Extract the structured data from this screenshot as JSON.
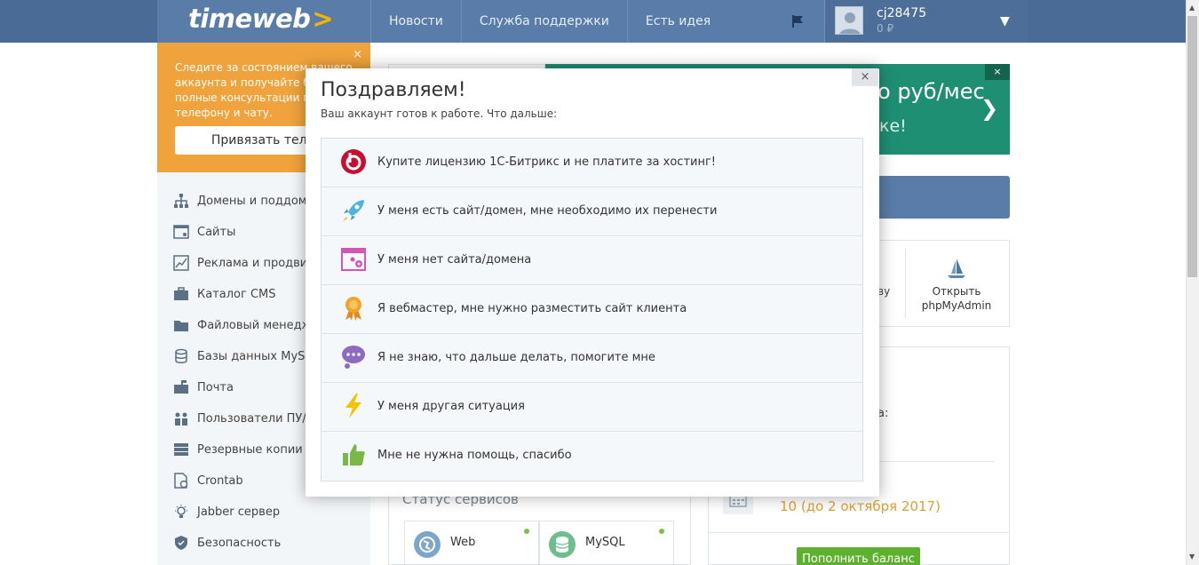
{
  "brand": {
    "logo_text": "timeweb",
    "logo_mark": ">",
    "accent": "#f5b400"
  },
  "nav": {
    "items": [
      "Новости",
      "Служба поддержки",
      "Есть идея"
    ]
  },
  "user": {
    "name": "cj28475",
    "balance": "0 ₽"
  },
  "notification": {
    "text": "Следите за состоянием вашего аккаунта и получайте бо... полные консультации по... телефону и чату.",
    "text_lines": [
      "Следите за состоянием вашего",
      "аккаунта и получайте бо",
      "полные консультации по",
      "телефону и чату."
    ],
    "button_label": "Привязать телеф",
    "close": "×"
  },
  "sidebar": {
    "items": [
      {
        "label": "Домены и поддоме",
        "icon": "sitemap-icon"
      },
      {
        "label": "Сайты",
        "icon": "site-window-icon"
      },
      {
        "label": "Реклама и продвиже",
        "icon": "chart-icon"
      },
      {
        "label": "Каталог CMS",
        "icon": "briefcase-icon"
      },
      {
        "label": "Файловый менеджер",
        "icon": "folder-icon"
      },
      {
        "label": "Базы данных MySQL",
        "icon": "database-icon"
      },
      {
        "label": "Почта",
        "icon": "mailbox-icon"
      },
      {
        "label": "Пользователи ПУ/FT",
        "icon": "users-icon"
      },
      {
        "label": "Резервные копии",
        "icon": "backup-icon"
      },
      {
        "label": "Crontab",
        "icon": "clock-file-icon"
      },
      {
        "label": "Jabber сервер",
        "icon": "bulb-icon"
      },
      {
        "label": "Безопасность",
        "icon": "shield-icon"
      }
    ]
  },
  "promo": {
    "price": "о руб/мес",
    "sub": "ке!",
    "close": "×"
  },
  "tools": {
    "fragment": "ву",
    "phpmyadmin_label_1": "Открыть",
    "phpmyadmin_label_2": "phpMyAdmin"
  },
  "status": {
    "title": "Статус сервисов",
    "services": [
      {
        "name": "Web",
        "color": "#7ea6c8"
      },
      {
        "name": "MySQL",
        "color": "#6cbf8c"
      }
    ]
  },
  "info": {
    "colon_fragment": "а:",
    "days_text": "10 (до 2 октября 2017)",
    "pay_button": "Пополнить баланс"
  },
  "modal": {
    "title": "Поздравляем!",
    "subtitle": "Ваш аккаунт готов к работе. Что дальше:",
    "close": "×",
    "options": [
      {
        "label": "Купите лицензию 1С-Битрикс и не платите за хостинг!",
        "icon": "bitrix-icon",
        "color": "#c8102e"
      },
      {
        "label": "У меня есть сайт/домен, мне необходимо их перенести",
        "icon": "rocket-icon",
        "color": "#4fb3e0"
      },
      {
        "label": "У меня нет сайта/домена",
        "icon": "browser-gear-icon",
        "color": "#d456b3"
      },
      {
        "label": "Я вебмастер, мне нужно разместить сайт клиента",
        "icon": "award-icon",
        "color": "#f2a32b"
      },
      {
        "label": "Я не знаю, что дальше делать, помогите мне",
        "icon": "thought-bubble-icon",
        "color": "#8e6bc2"
      },
      {
        "label": "У меня другая ситуация",
        "icon": "lightning-icon",
        "color": "#f5c200"
      },
      {
        "label": "Мне не нужна помощь, спасибо",
        "icon": "thumbs-up-icon",
        "color": "#7ab648"
      }
    ]
  }
}
